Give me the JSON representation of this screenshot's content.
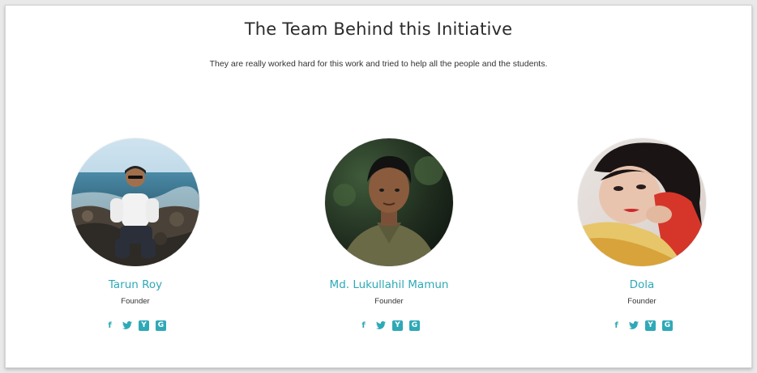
{
  "section": {
    "title": "The Team Behind this Initiative",
    "subtitle": "They are really worked hard for this work and tried to help all the people and the students."
  },
  "colors": {
    "accent": "#2fa9b7",
    "text": "#333333"
  },
  "members": [
    {
      "name": "Tarun Roy",
      "role": "Founder",
      "socials": [
        "facebook-icon",
        "twitter-icon",
        "yahoo-icon",
        "google-icon"
      ]
    },
    {
      "name": "Md. Lukullahil Mamun",
      "role": "Founder",
      "socials": [
        "facebook-icon",
        "twitter-icon",
        "yahoo-icon",
        "google-icon"
      ]
    },
    {
      "name": "Dola",
      "role": "Founder",
      "socials": [
        "facebook-icon",
        "twitter-icon",
        "yahoo-icon",
        "google-icon"
      ]
    }
  ],
  "social_glyphs": {
    "facebook": "f",
    "yahoo": "Y",
    "google": "G"
  }
}
